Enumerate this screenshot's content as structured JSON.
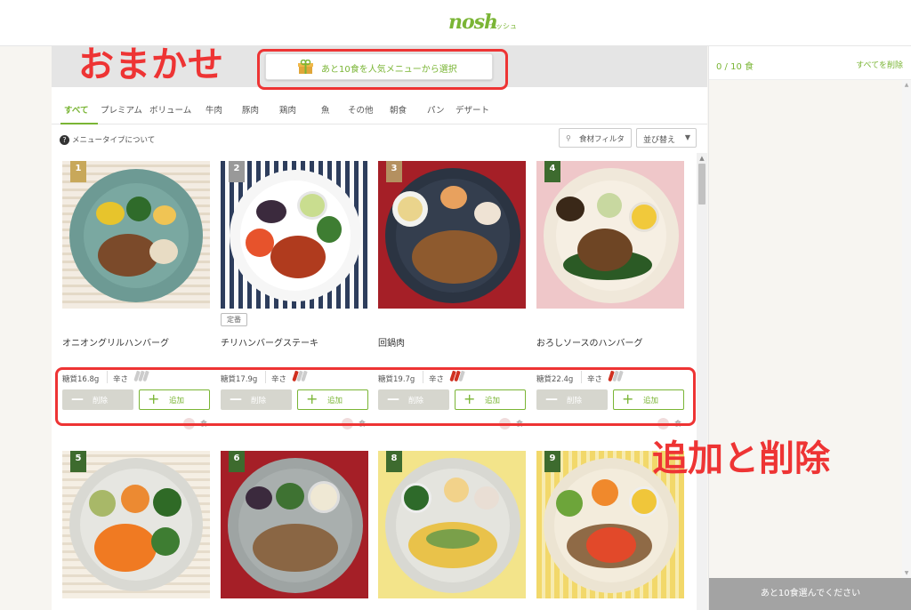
{
  "header": {
    "logo": "nosh",
    "logo_sub": "ナッシュ"
  },
  "omakase": {
    "label": "あと10食を人気メニューから選択"
  },
  "annotations": {
    "omakase": "おまかせ",
    "add_delete": "追加と削除"
  },
  "tabs": [
    {
      "label": "すべて",
      "active": true
    },
    {
      "label": "プレミアム"
    },
    {
      "label": "ボリューム"
    },
    {
      "label": "牛肉"
    },
    {
      "label": "豚肉"
    },
    {
      "label": "鶏肉"
    },
    {
      "label": "魚"
    },
    {
      "label": "その他"
    },
    {
      "label": "朝食"
    },
    {
      "label": "パン"
    },
    {
      "label": "デザート"
    }
  ],
  "toolbar": {
    "about": "メニュータイプについて",
    "filter": "食材フィルタ",
    "sort": "並び替え"
  },
  "buttons": {
    "delete": "削除",
    "add": "追加",
    "count_suffix": "食"
  },
  "spicy_label": "辛さ",
  "items": [
    {
      "num": "1",
      "name": "オニオングリルハンバーグ",
      "sugar": "糖質16.8g",
      "spicy": 0
    },
    {
      "num": "2",
      "name": "チリハンバーグステーキ",
      "tag": "定番",
      "sugar": "糖質17.9g",
      "spicy": 1
    },
    {
      "num": "3",
      "name": "回鍋肉",
      "sugar": "糖質19.7g",
      "spicy": 2
    },
    {
      "num": "4",
      "name": "おろしソースのハンバーグ",
      "sugar": "糖質22.4g",
      "spicy": 1
    },
    {
      "num": "5"
    },
    {
      "num": "6"
    },
    {
      "num": "8"
    },
    {
      "num": "9"
    }
  ],
  "cart": {
    "count": "0 / 10 食",
    "delete_all": "すべてを削除",
    "footer": "あと10食選んでください"
  },
  "colors": {
    "accent": "#7ab535",
    "annotation": "#ee3434",
    "chili": "#d03020"
  }
}
